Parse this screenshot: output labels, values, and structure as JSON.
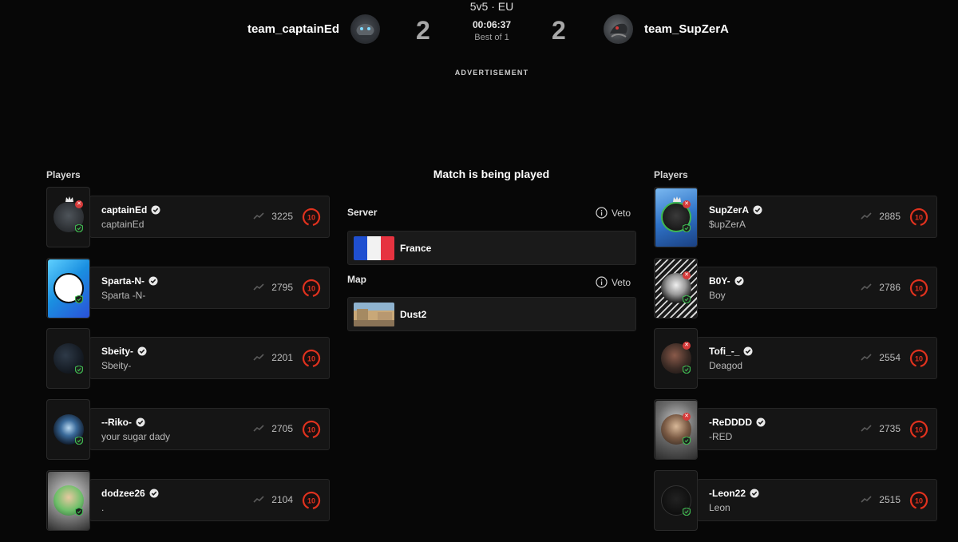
{
  "header": {
    "mode": "5v5 · EU",
    "timer": "00:06:37",
    "best_of": "Best of 1",
    "advertisement": "ADVERTISEMENT",
    "team_left": {
      "name": "team_captainEd",
      "score": "2"
    },
    "team_right": {
      "name": "team_SupZerA",
      "score": "2"
    }
  },
  "left_section_title": "Players",
  "right_section_title": "Players",
  "status_title": "Match is being played",
  "server": {
    "label": "Server",
    "veto_label": "Veto",
    "value": "France"
  },
  "map": {
    "label": "Map",
    "veto_label": "Veto",
    "value": "Dust2"
  },
  "left_players": [
    {
      "nick": "captainEd",
      "name": "captainEd",
      "elo": "3225",
      "level": "10"
    },
    {
      "nick": "Sparta-N-",
      "name": "Sparta -N-",
      "elo": "2795",
      "level": "10"
    },
    {
      "nick": "Sbeity-",
      "name": "Sbeity-",
      "elo": "2201",
      "level": "10"
    },
    {
      "nick": "--Riko-",
      "name": "your sugar dady",
      "elo": "2705",
      "level": "10"
    },
    {
      "nick": "dodzee26",
      "name": ".",
      "elo": "2104",
      "level": "10"
    }
  ],
  "right_players": [
    {
      "nick": "SupZerA",
      "name": "$upZerA",
      "elo": "2885",
      "level": "10"
    },
    {
      "nick": "B0Y-",
      "name": "Boy",
      "elo": "2786",
      "level": "10"
    },
    {
      "nick": "Tofi_-_",
      "name": "Deagod",
      "elo": "2554",
      "level": "10"
    },
    {
      "nick": "-ReDDDD",
      "name": "-RED",
      "elo": "2735",
      "level": "10"
    },
    {
      "nick": "-Leon22",
      "name": "Leon",
      "elo": "2515",
      "level": "10"
    }
  ],
  "colors": {
    "background": "#070707",
    "card": "#151515",
    "level_ring": "#e0321e",
    "badge_red": "#d63a3a",
    "badge_green": "#3fb950",
    "flag_blue": "#1f4fd0",
    "flag_white": "#f2f2f2",
    "flag_red": "#e63340"
  },
  "icons": {
    "verified": "verified-check-icon",
    "elo_trend": "trend-icon",
    "info": "info-icon",
    "crown": "crown-icon",
    "anti_cheat": "shield-icon",
    "remove": "close-icon"
  }
}
